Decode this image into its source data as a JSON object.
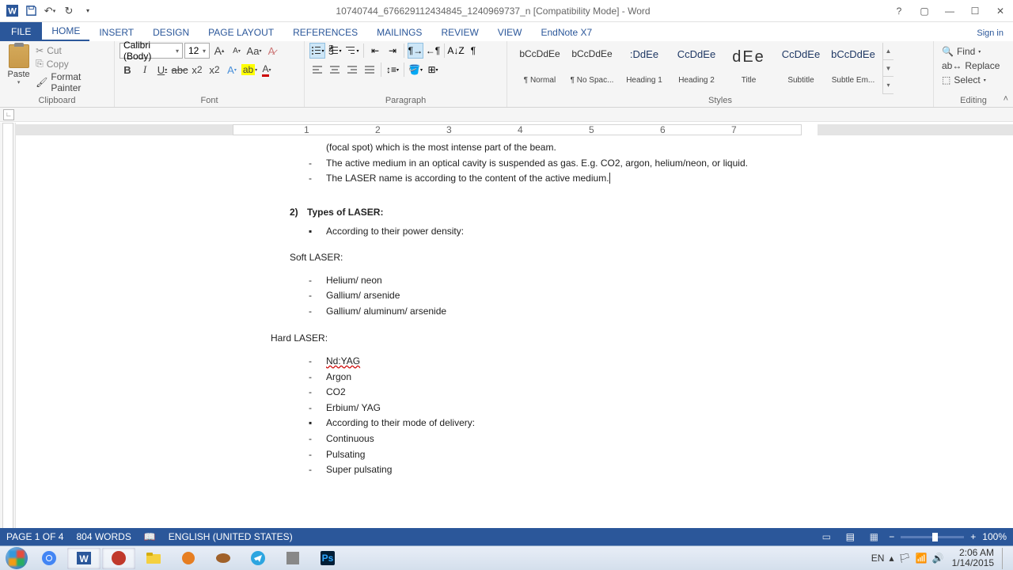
{
  "title": "10740744_676629112434845_1240969737_n [Compatibility Mode] - Word",
  "signin": "Sign in",
  "tabs": {
    "file": "FILE",
    "home": "HOME",
    "insert": "INSERT",
    "design": "DESIGN",
    "pageLayout": "PAGE LAYOUT",
    "references": "REFERENCES",
    "mailings": "MAILINGS",
    "review": "REVIEW",
    "view": "VIEW",
    "endnote": "EndNote X7"
  },
  "clipboard": {
    "paste": "Paste",
    "cut": "Cut",
    "copy": "Copy",
    "formatPainter": "Format Painter",
    "label": "Clipboard"
  },
  "font": {
    "name": "Calibri (Body)",
    "size": "12",
    "label": "Font"
  },
  "paragraph": {
    "label": "Paragraph"
  },
  "styles": {
    "label": "Styles",
    "items": [
      {
        "preview": "bCcDdEe",
        "name": "¶ Normal",
        "cls": "normal"
      },
      {
        "preview": "bCcDdEe",
        "name": "¶ No Spac...",
        "cls": "normal"
      },
      {
        "preview": ":DdEe",
        "name": "Heading 1",
        "cls": ""
      },
      {
        "preview": "CcDdEe",
        "name": "Heading 2",
        "cls": ""
      },
      {
        "preview": "dEe",
        "name": "Title",
        "cls": "title"
      },
      {
        "preview": "CcDdEe",
        "name": "Subtitle",
        "cls": ""
      },
      {
        "preview": "bCcDdEe",
        "name": "Subtle Em...",
        "cls": ""
      }
    ]
  },
  "editing": {
    "find": "Find",
    "replace": "Replace",
    "select": "Select",
    "label": "Editing"
  },
  "ruler_numbers": [
    "1",
    "2",
    "3",
    "4",
    "5",
    "6",
    "7"
  ],
  "document": {
    "line1": "(focal spot) which is the most intense part of the beam.",
    "line2": "The active medium in an optical cavity is suspended as gas. E.g. CO2, argon, helium/neon, or liquid.",
    "line3": "The LASER name is according to the content of the active medium.",
    "section_num": "2)",
    "section_title": "Types of LASER:",
    "sub1": "According to their power density:",
    "soft": "Soft LASER:",
    "soft_items": [
      "Helium/ neon",
      "Gallium/ arsenide",
      "Gallium/ aluminum/ arsenide"
    ],
    "hard": "Hard LASER:",
    "hard_items": [
      "Nd:YAG",
      "Argon",
      "CO2",
      "Erbium/ YAG"
    ],
    "sub2": "According to their mode of delivery:",
    "mode_items": [
      "Continuous",
      "Pulsating",
      "Super pulsating"
    ]
  },
  "status": {
    "page": "PAGE 1 OF 4",
    "words": "804 WORDS",
    "lang": "ENGLISH (UNITED STATES)",
    "zoom": "100%"
  },
  "tray": {
    "lang": "EN",
    "time": "2:06 AM",
    "date": "1/14/2015"
  }
}
